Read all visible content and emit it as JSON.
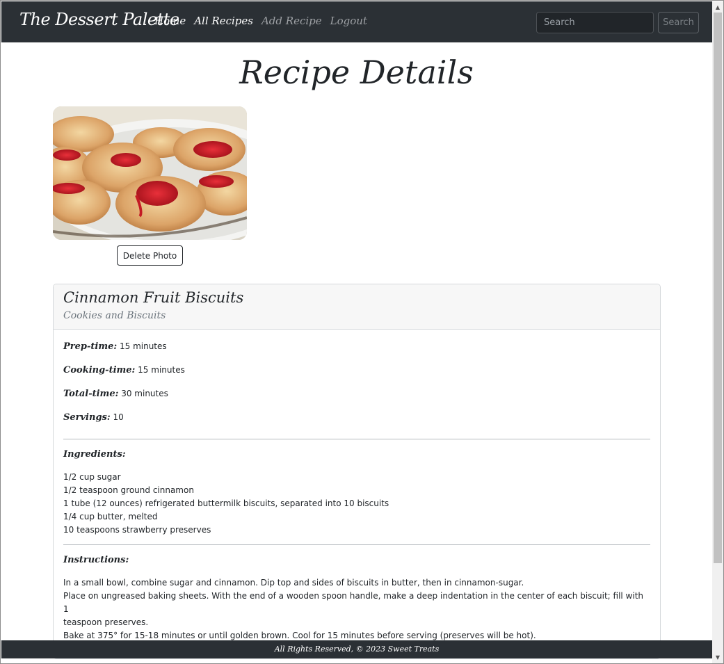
{
  "navbar": {
    "brand": "The Dessert Palette",
    "links": [
      {
        "label": "Home"
      },
      {
        "label": "All Recipes"
      },
      {
        "label": "Add Recipe"
      },
      {
        "label": "Logout"
      }
    ],
    "search_placeholder": "Search",
    "search_button": "Search"
  },
  "page": {
    "title": "Recipe Details",
    "delete_photo_label": "Delete Photo"
  },
  "recipe": {
    "name": "Cinnamon Fruit Biscuits",
    "category": "Cookies and Biscuits",
    "meta": [
      {
        "label": "Prep-time:",
        "value": "15 minutes"
      },
      {
        "label": "Cooking-time:",
        "value": "15 minutes"
      },
      {
        "label": "Total-time:",
        "value": "30 minutes"
      },
      {
        "label": "Servings:",
        "value": "10"
      }
    ],
    "ingredients_label": "Ingredients:",
    "ingredients": [
      "1/2 cup sugar",
      "1/2 teaspoon ground cinnamon",
      "1 tube (12 ounces) refrigerated buttermilk biscuits, separated into 10 biscuits",
      "1/4 cup butter, melted",
      "10 teaspoons strawberry preserves"
    ],
    "instructions_label": "Instructions:",
    "instructions": [
      "In a small bowl, combine sugar and cinnamon. Dip top and sides of biscuits in butter, then in cinnamon-sugar.",
      "Place on ungreased baking sheets. With the end of a wooden spoon handle, make a deep indentation in the center of each biscuit; fill with 1",
      "teaspoon preserves.",
      "Bake at 375° for 15-18 minutes or until golden brown. Cool for 15 minutes before serving (preserves will be hot)."
    ]
  },
  "footer": {
    "text": "All Rights Reserved, © 2023 Sweet Treats"
  },
  "colors": {
    "navbar_bg": "#2b3035",
    "muted_link": "#9ea1a5",
    "subtitle": "#6c757d"
  }
}
